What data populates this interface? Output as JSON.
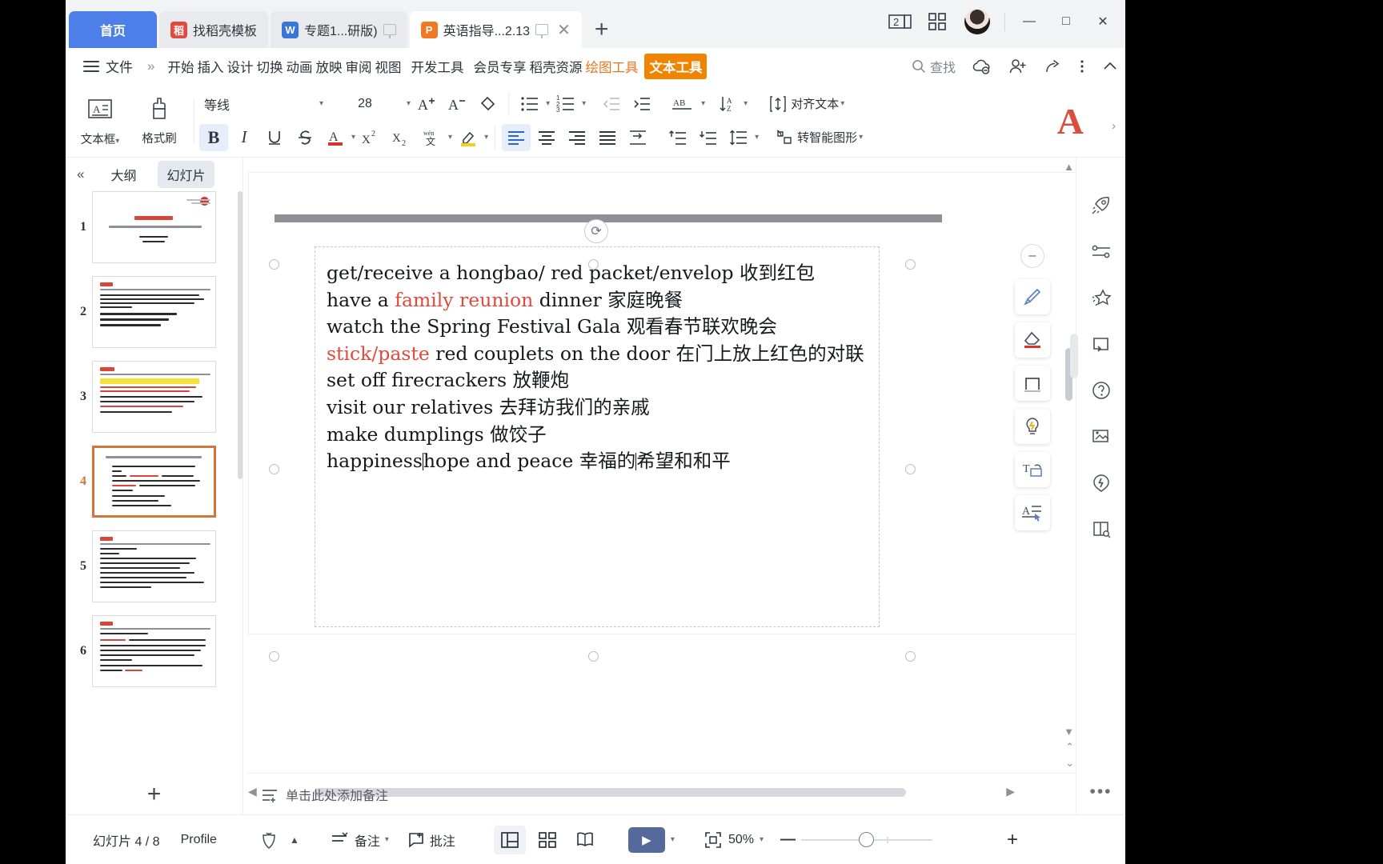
{
  "window": {
    "tabs": [
      {
        "label": "首页",
        "kind": "home"
      },
      {
        "label": "找稻壳模板",
        "kind": "plain",
        "icon": "docer-icon",
        "badge": "稻"
      },
      {
        "label": "专题1...研版)",
        "kind": "plain",
        "icon": "writer-icon",
        "badge": "W"
      },
      {
        "label": "英语指导...2.13",
        "kind": "active",
        "icon": "presentation-icon",
        "badge": "P"
      }
    ],
    "new_tab": "+",
    "counter": "2",
    "minimize": "—",
    "maximize": "□",
    "close": "✕"
  },
  "menu": {
    "file": "文件",
    "more": "»",
    "items": [
      {
        "label": "开始"
      },
      {
        "label": "插入"
      },
      {
        "label": "设计"
      },
      {
        "label": "切换"
      },
      {
        "label": "动画"
      },
      {
        "label": "放映"
      },
      {
        "label": "审阅"
      },
      {
        "label": "视图"
      },
      {
        "label": "开发工具"
      },
      {
        "label": "会员专享"
      },
      {
        "label": "稻壳资源"
      },
      {
        "label": "绘图工具",
        "style": "orange"
      },
      {
        "label": "文本工具",
        "style": "highlight"
      }
    ],
    "find": "查找"
  },
  "ribbon": {
    "textbox_label": "文本框",
    "formatpainter_label": "格式刷",
    "font_name": "等线",
    "font_size": "28",
    "align_text_label": "对齐文本",
    "smartart_label": "转智能图形",
    "big_letter": "A"
  },
  "thumbpanel": {
    "collapse": "«",
    "tab_outline": "大纲",
    "tab_slides": "幻灯片",
    "selected_tab": "幻灯片",
    "slides": [
      {
        "number": "1"
      },
      {
        "number": "2"
      },
      {
        "number": "3"
      },
      {
        "number": "4",
        "current": true
      },
      {
        "number": "5"
      },
      {
        "number": "6"
      }
    ],
    "add_slide": "+"
  },
  "slide": {
    "lines": [
      {
        "segments": [
          {
            "t": "get/receive a hongbao/ red packet/envelop 收到红包"
          }
        ]
      },
      {
        "segments": [
          {
            "t": "have a "
          },
          {
            "t": "family reunion",
            "c": "red"
          },
          {
            "t": " dinner 家庭晚餐"
          }
        ]
      },
      {
        "segments": [
          {
            "t": "watch the Spring Festival Gala 观看春节联欢晚会"
          }
        ]
      },
      {
        "segments": [
          {
            "t": "stick/paste",
            "c": "red"
          },
          {
            "t": " red couplets on the door 在门上放上红色的对联"
          }
        ]
      },
      {
        "segments": [
          {
            "t": "set off firecrackers 放鞭炮"
          }
        ]
      },
      {
        "segments": [
          {
            "t": "visit our relatives 去拜访我们的亲戚"
          }
        ]
      },
      {
        "segments": [
          {
            "t": "make dumplings 做饺子"
          }
        ]
      },
      {
        "segments": [
          {
            "t": "happiness"
          },
          {
            "cursor": true
          },
          {
            "t": "hope and peace 幸福的"
          },
          {
            "cursor": true
          },
          {
            "t": "希望和和平"
          }
        ]
      }
    ],
    "accent_red": "#e2493b"
  },
  "notes": {
    "placeholder": "单击此处添加备注"
  },
  "status": {
    "slide_counter": "幻灯片 4 / 8",
    "profile": "Profile",
    "notes_btn": "备注",
    "comment_btn": "批注",
    "zoom_value": "50%",
    "zoom_out": "—",
    "zoom_in": "+",
    "up_caret": "▲"
  }
}
